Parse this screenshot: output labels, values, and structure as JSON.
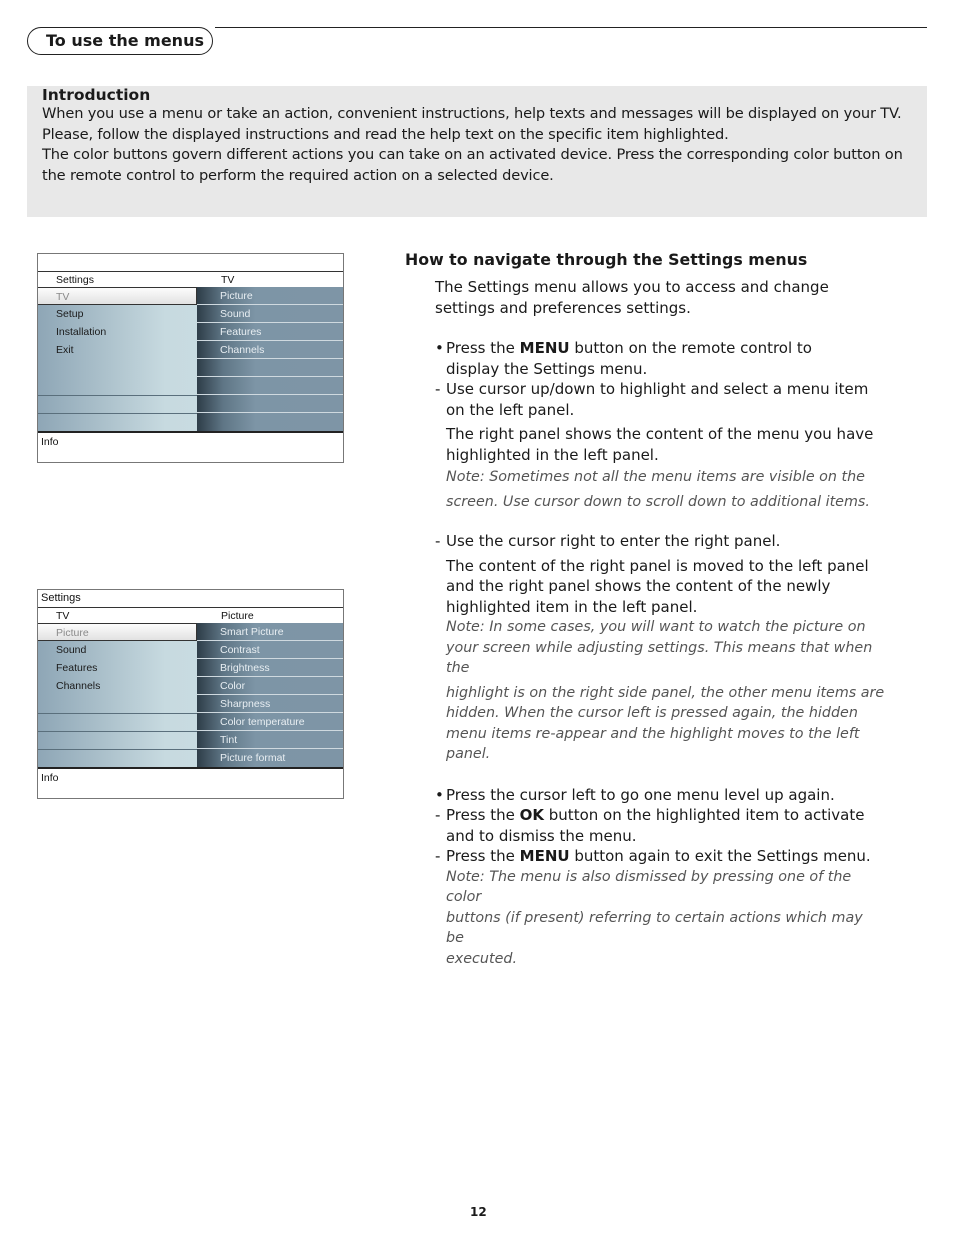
{
  "section": {
    "title": "To use the menus"
  },
  "intro": {
    "heading": "Introduction",
    "lines": [
      "When you use a menu or take an action, convenient instructions, help texts and messages will be displayed on your TV.",
      "Please, follow the displayed instructions and read the help text on the specific item highlighted.",
      "The color buttons govern different actions you can take on an activated device. Press the corresponding color button on",
      "the remote control to perform the required action on a selected device."
    ]
  },
  "screen1": {
    "header": "",
    "left_title": "Settings",
    "right_title": "TV",
    "left_items": [
      "TV",
      "Setup",
      "Installation",
      "Exit",
      "",
      "",
      "",
      ""
    ],
    "right_items": [
      "Picture",
      "Sound",
      "Features",
      "Channels",
      "",
      "",
      "",
      ""
    ],
    "highlighted_index": 0,
    "footer": "Info"
  },
  "screen2": {
    "header": "Settings",
    "left_title": "TV",
    "right_title": "Picture",
    "left_items": [
      "Picture",
      "Sound",
      "Features",
      "Channels",
      "",
      "",
      "",
      ""
    ],
    "right_items": [
      "Smart Picture",
      "Contrast",
      "Brightness",
      "Color",
      "Sharpness",
      "Color temperature",
      "Tint",
      "Picture format"
    ],
    "highlighted_index": 0,
    "footer": "Info"
  },
  "nav": {
    "heading": "How to navigate through the Settings menus",
    "intro": [
      "The Settings menu allows you to access and change",
      "settings and preferences settings."
    ],
    "step1_pre": "Press the ",
    "step1_bold": "MENU",
    "step1_post": " button on the remote control to",
    "step1_line2": "display the Settings menu.",
    "step2": [
      "Use cursor up/down to highlight and select a menu item",
      "on the left panel."
    ],
    "step2_detail": [
      "The right panel shows the content of the  menu you have",
      "highlighted in the left panel."
    ],
    "note1": [
      "Note: Sometimes not all the menu items are visible on the",
      "screen. Use cursor down to scroll down to additional items."
    ],
    "step3": "Use the cursor right to enter the right panel.",
    "step3_detail": [
      "The content of the right panel is moved to the left panel",
      "and the right panel shows the content of the newly",
      "highlighted item in the left panel."
    ],
    "note2": [
      "Note: In some cases, you will want to watch the picture on",
      "your screen while adjusting settings. This means that when the",
      "highlight is on the right side panel, the other menu items are",
      "hidden. When the cursor left is pressed again, the hidden",
      "menu items re-appear and the highlight moves to the left",
      "panel."
    ],
    "step4": "Press the cursor left to go one menu level up again.",
    "step5_pre": "Press the ",
    "step5_bold": "OK",
    "step5_post": " button on the highlighted item to activate",
    "step5_line2": "and to dismiss the menu.",
    "step6_pre": "Press the ",
    "step6_bold": "MENU",
    "step6_post": " button again to exit the Settings menu.",
    "note3": [
      "Note: The menu is also dismissed by pressing one of the color",
      "buttons (if present) referring to certain actions which may be",
      "executed."
    ],
    "bullet": "•",
    "dash": "-"
  },
  "page_number": "12"
}
